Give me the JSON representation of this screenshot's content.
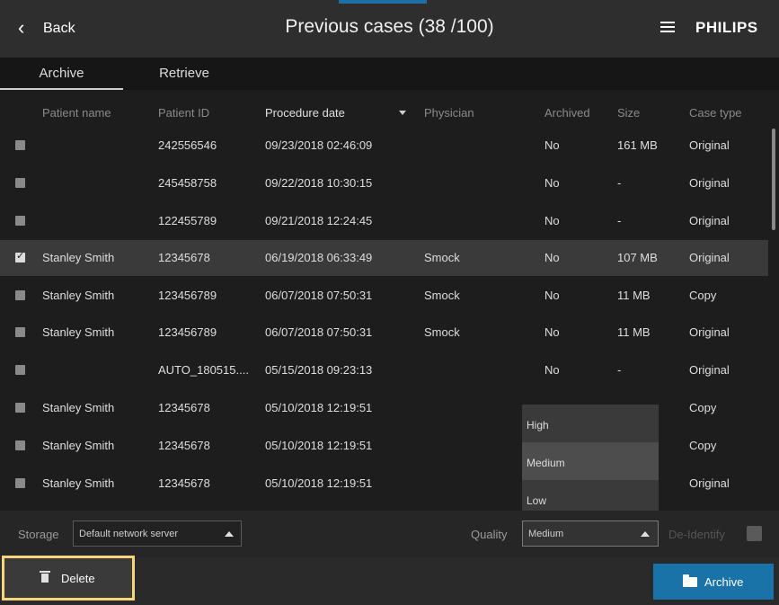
{
  "header": {
    "back_label": "Back",
    "title": "Previous cases (38 /100)",
    "brand": "PHILIPS"
  },
  "tabs": [
    {
      "label": "Archive",
      "active": true
    },
    {
      "label": "Retrieve",
      "active": false
    }
  ],
  "columns": {
    "patient_name": "Patient name",
    "patient_id": "Patient ID",
    "procedure_date": "Procedure date",
    "physician": "Physician",
    "archived": "Archived",
    "size": "Size",
    "case_type": "Case type",
    "sorted_by": "Procedure date"
  },
  "rows": [
    {
      "checked": false,
      "name": "",
      "id": "242556546",
      "date": "09/23/2018 02:46:09",
      "physician": "",
      "archived": "No",
      "size": "161 MB",
      "type": "Original"
    },
    {
      "checked": false,
      "name": "",
      "id": "245458758",
      "date": "09/22/2018 10:30:15",
      "physician": "",
      "archived": "No",
      "size": "-",
      "type": "Original"
    },
    {
      "checked": false,
      "name": "",
      "id": "122455789",
      "date": "09/21/2018 12:24:45",
      "physician": "",
      "archived": "No",
      "size": "-",
      "type": "Original"
    },
    {
      "checked": true,
      "name": "Stanley Smith",
      "id": "12345678",
      "date": "06/19/2018 06:33:49",
      "physician": "Smock",
      "archived": "No",
      "size": "107 MB",
      "type": "Original"
    },
    {
      "checked": false,
      "name": "Stanley Smith",
      "id": "123456789",
      "date": "06/07/2018 07:50:31",
      "physician": "Smock",
      "archived": "No",
      "size": "11 MB",
      "type": "Copy"
    },
    {
      "checked": false,
      "name": "Stanley Smith",
      "id": "123456789",
      "date": "06/07/2018 07:50:31",
      "physician": "Smock",
      "archived": "No",
      "size": "11 MB",
      "type": "Original"
    },
    {
      "checked": false,
      "name": "",
      "id": "AUTO_180515....",
      "date": "05/15/2018 09:23:13",
      "physician": "",
      "archived": "No",
      "size": "-",
      "type": "Original"
    },
    {
      "checked": false,
      "name": "Stanley Smith",
      "id": "12345678",
      "date": "05/10/2018 12:19:51",
      "physician": "",
      "archived": "",
      "size": "",
      "type": "Copy"
    },
    {
      "checked": false,
      "name": "Stanley Smith",
      "id": "12345678",
      "date": "05/10/2018 12:19:51",
      "physician": "",
      "archived": "",
      "size": "",
      "type": "Copy"
    },
    {
      "checked": false,
      "name": "Stanley Smith",
      "id": "12345678",
      "date": "05/10/2018 12:19:51",
      "physician": "",
      "archived": "",
      "size": "",
      "type": "Original"
    }
  ],
  "quality_options": [
    {
      "label": "High",
      "active": false
    },
    {
      "label": "Medium",
      "active": true
    },
    {
      "label": "Low",
      "active": false
    }
  ],
  "storage": {
    "label": "Storage",
    "value": "Default network server"
  },
  "quality": {
    "label": "Quality",
    "value": "Medium"
  },
  "deidentify": {
    "label": "De-Identify",
    "checked": false
  },
  "footer": {
    "delete_label": "Delete",
    "archive_label": "Archive"
  },
  "colors": {
    "background": "#1d1d1d",
    "header": "#2e2e2e",
    "selected_row": "#3a3a3a",
    "archive_button": "#1a73a8",
    "delete_highlight": "#f5d57a"
  },
  "icons": {
    "back": "chevron-left-icon",
    "menu": "hamburger-menu-icon",
    "sort": "sort-descending-icon",
    "delete": "trash-icon",
    "archive": "folder-icon"
  }
}
